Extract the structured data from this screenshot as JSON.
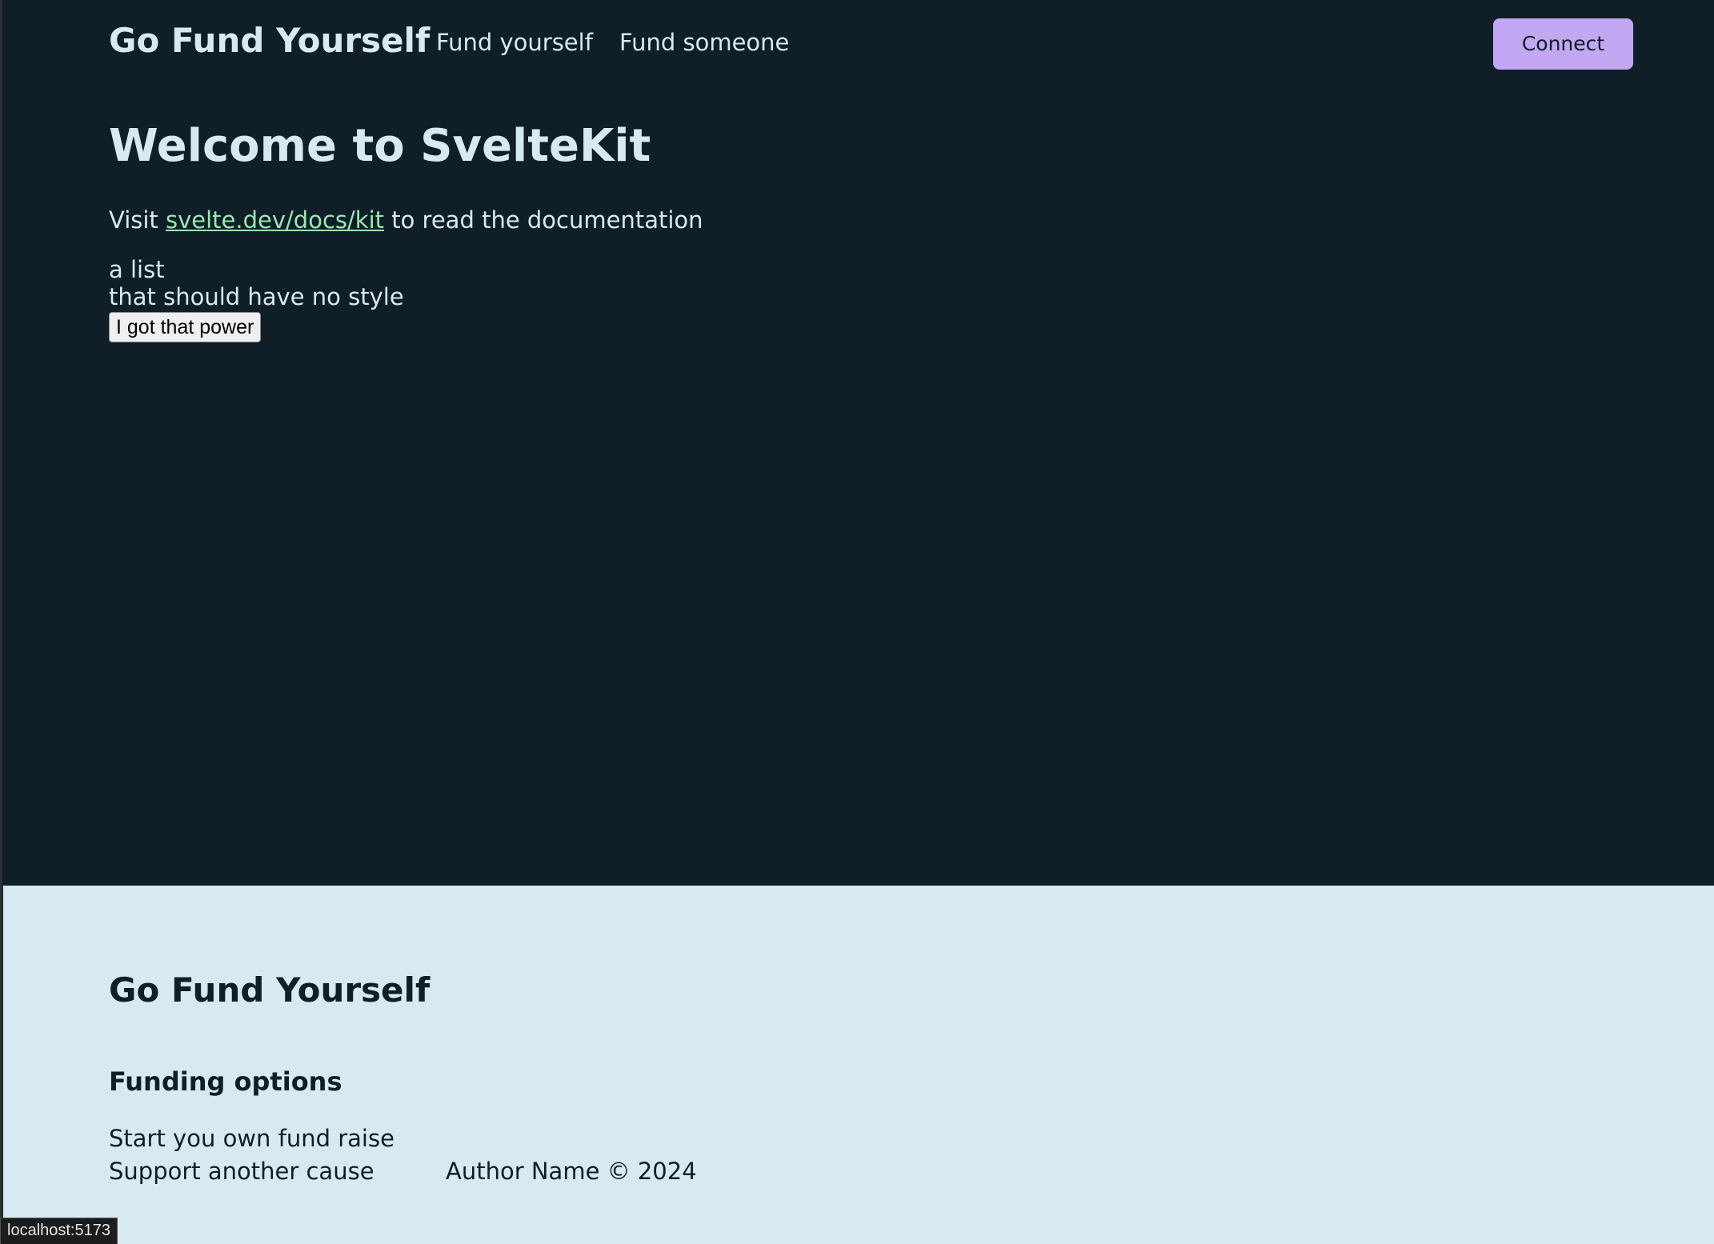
{
  "header": {
    "brand": "Go Fund Yourself",
    "nav": [
      {
        "label": "Fund yourself"
      },
      {
        "label": "Fund someone"
      }
    ],
    "connect_label": "Connect"
  },
  "main": {
    "title": "Welcome to SvelteKit",
    "visit_prefix": "Visit ",
    "docs_link": "svelte.dev/docs/kit",
    "visit_suffix": " to read the documentation",
    "list": [
      "a list",
      "that should have no style"
    ],
    "power_button": "I got that power"
  },
  "footer": {
    "brand": "Go Fund Yourself",
    "heading": "Funding options",
    "links": [
      "Start you own fund raise",
      "Support another cause"
    ],
    "copyright": "Author Name © 2024"
  },
  "statusbar": {
    "url": "localhost:5173"
  },
  "colors": {
    "background": "#0f1e27",
    "text_light": "#d7e9f1",
    "accent_button": "#c2a8f2",
    "link": "#9ae7b0",
    "footer_background": "#d8e9f1"
  }
}
